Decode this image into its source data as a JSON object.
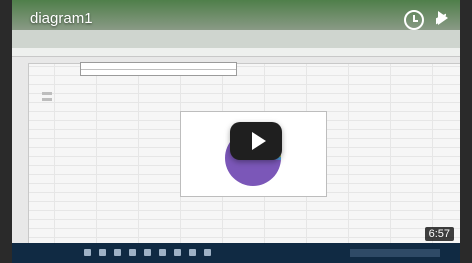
{
  "video": {
    "title": "diagram1",
    "duration": "6:57"
  },
  "icons": {
    "watch_later": "clock-icon",
    "share": "share-arrow-icon",
    "play": "play-icon"
  },
  "colors": {
    "pie_primary": "#7b57b8",
    "pie_secondary": "#2f5c9a",
    "pie_accent": "#a8c44b",
    "pie_small": "#4c9ed9"
  }
}
